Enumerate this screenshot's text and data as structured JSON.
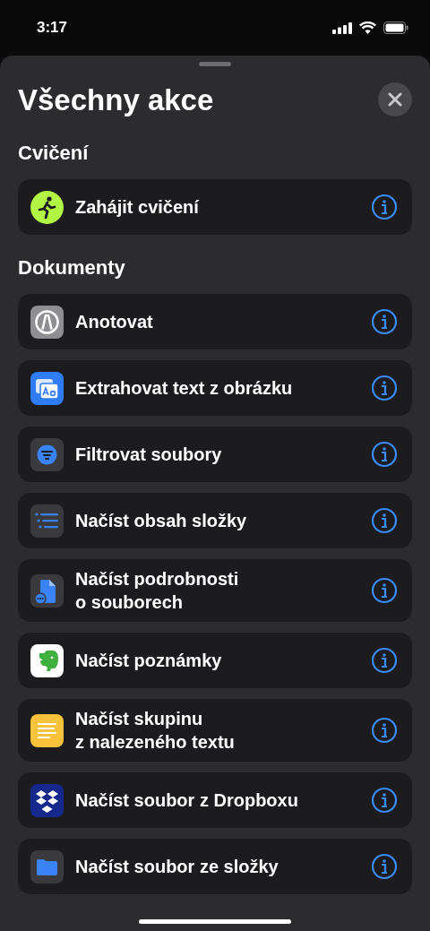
{
  "status_bar": {
    "time": "3:17"
  },
  "sheet": {
    "title": "Všechny akce"
  },
  "sections": [
    {
      "heading": "Cvičení",
      "actions": [
        {
          "label": "Zahájit cvičení",
          "kind": "workout"
        }
      ]
    },
    {
      "heading": "Dokumenty",
      "actions": [
        {
          "label": "Anotovat",
          "kind": "markup"
        },
        {
          "label": "Extrahovat text z obrázku",
          "kind": "text"
        },
        {
          "label": "Filtrovat soubory",
          "kind": "filter"
        },
        {
          "label": "Načíst obsah složky",
          "kind": "list"
        },
        {
          "label": "Načíst podrobnosti\no souborech",
          "kind": "file"
        },
        {
          "label": "Načíst poznámky",
          "kind": "elephant"
        },
        {
          "label": "Načíst skupinu\nz nalezeného textu",
          "kind": "note"
        },
        {
          "label": "Načíst soubor z Dropboxu",
          "kind": "box"
        },
        {
          "label": "Načíst soubor ze složky",
          "kind": "folder"
        }
      ]
    }
  ]
}
